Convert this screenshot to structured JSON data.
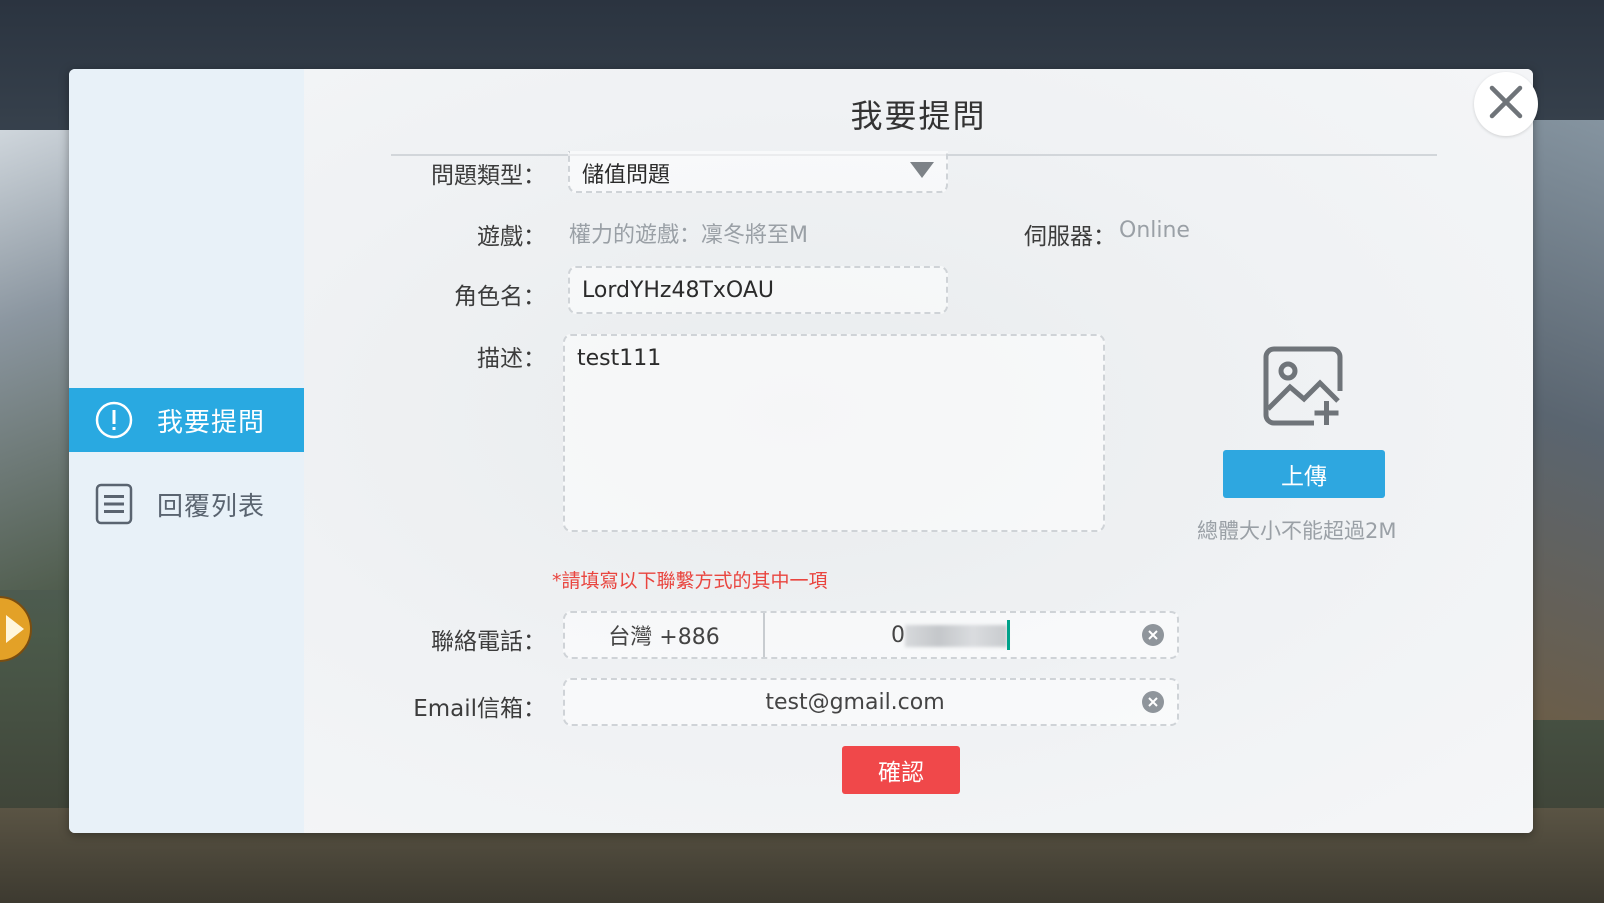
{
  "sidebar": {
    "items": [
      {
        "label": "我要提問",
        "icon": "exclamation-circle-icon",
        "active": true
      },
      {
        "label": "回覆列表",
        "icon": "list-icon",
        "active": false
      }
    ]
  },
  "form": {
    "title": "我要提問",
    "question_type": {
      "label": "問題類型：",
      "value": "儲值問題"
    },
    "game": {
      "label": "遊戲：",
      "value": "權力的遊戲：凜冬將至M"
    },
    "server": {
      "label": "伺服器：",
      "value": "Online"
    },
    "role_name": {
      "label": "角色名：",
      "value": "LordYHz48TxOAU"
    },
    "description": {
      "label": "描述：",
      "value": "test111"
    },
    "contact_note": "*請填寫以下聯繫方式的其中一項",
    "phone": {
      "label": "聯絡電話：",
      "country": "台灣 +886",
      "value": "0"
    },
    "email": {
      "label": "Email信箱：",
      "value": "test@gmail.com"
    },
    "confirm_label": "確認"
  },
  "upload": {
    "button_label": "上傳",
    "hint": "總體大小不能超過2M",
    "icon": "add-image-icon"
  },
  "colors": {
    "accent": "#29a9e1",
    "confirm": "#f0484a",
    "note": "#e9453f",
    "sidebar_bg": "#e8f1f8"
  }
}
